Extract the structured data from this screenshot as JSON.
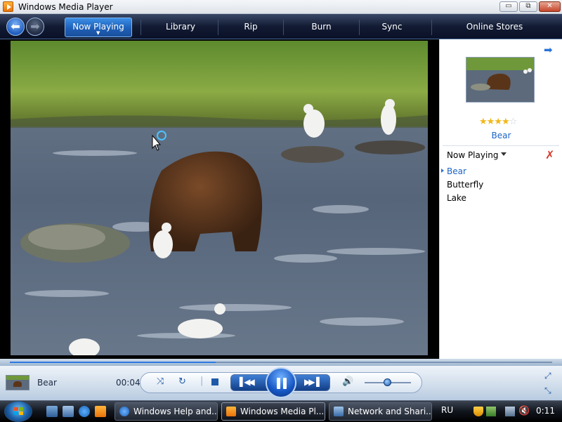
{
  "window": {
    "title": "Windows Media Player"
  },
  "titlebar_buttons": {
    "minimize": "▭",
    "maximize": "⧉",
    "close": "✕"
  },
  "nav": {
    "back_icon": "back-arrow-icon",
    "forward_icon": "forward-arrow-icon",
    "tabs": [
      {
        "label": "Now Playing",
        "active": true
      },
      {
        "label": "Library"
      },
      {
        "label": "Rip"
      },
      {
        "label": "Burn"
      },
      {
        "label": "Sync"
      },
      {
        "label": "Online Stores"
      }
    ]
  },
  "pane": {
    "current_title": "Bear",
    "rating": {
      "filled": 4,
      "total": 5
    },
    "list_header": "Now Playing",
    "playlist": [
      {
        "title": "Bear",
        "active": true
      },
      {
        "title": "Butterfly"
      },
      {
        "title": "Lake"
      }
    ]
  },
  "player": {
    "track_title": "Bear",
    "elapsed": "00:04",
    "seek_progress": 0.38,
    "volume_level": 0.5
  },
  "taskbar": {
    "tasks": [
      {
        "label": "Windows Help and...",
        "icon": "help-icon"
      },
      {
        "label": "Windows Media Pl...",
        "icon": "media-player-icon",
        "active": true
      },
      {
        "label": "Network and Shari...",
        "icon": "network-icon"
      }
    ],
    "language": "RU",
    "clock": "0:11"
  },
  "colors": {
    "accent": "#1e60b8",
    "link": "#1c64c4",
    "star": "#f2b718"
  }
}
